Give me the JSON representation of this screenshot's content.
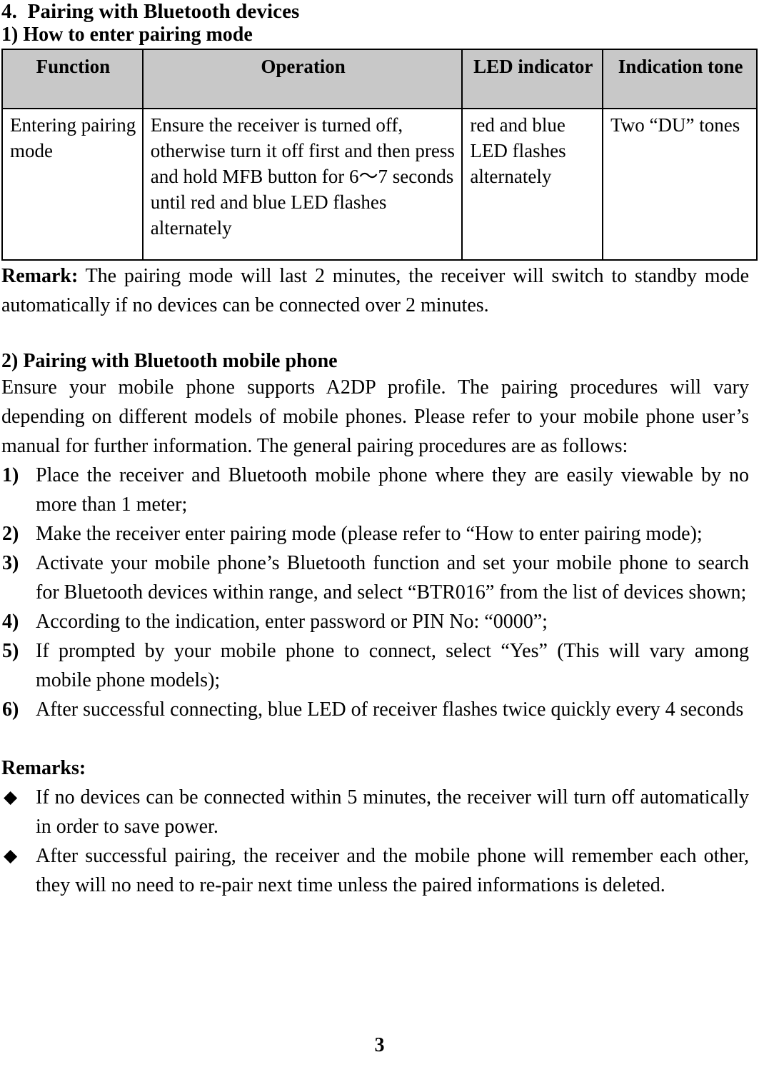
{
  "document": {
    "section_heading": "4.  Pairing with Bluetooth devices",
    "subsection_heading": "1) How to enter pairing mode",
    "page_number": "3"
  },
  "table": {
    "headers": {
      "function": "Function",
      "operation": "Operation",
      "led_indicator": "LED indicator",
      "indication_tone": "Indication tone"
    },
    "header_colors": {
      "background": "#c8c8c8",
      "border": "#000000"
    },
    "rows": [
      {
        "function": "Entering pairing mode",
        "operation": "Ensure the receiver is turned off, otherwise turn it off first and then press and hold MFB button for 6～7 seconds until red and blue LED flashes alternately",
        "led_indicator": "red and blue LED flashes alternately",
        "indication_tone": "Two  “DU” tones"
      }
    ]
  },
  "remark": {
    "label": "Remark:",
    "text": " The pairing mode will last 2 minutes, the receiver will switch to standby mode automatically if no devices can be connected over 2 minutes."
  },
  "pairing_phone": {
    "heading": "2) Pairing with Bluetooth mobile phone",
    "intro": "Ensure your mobile phone supports A2DP profile. The pairing procedures will vary depending on different models of mobile phones. Please refer to your mobile phone user’s manual for further information. The general pairing procedures are as follows:",
    "steps": [
      {
        "marker": "1)",
        "text": "Place the receiver and Bluetooth mobile phone where they are easily viewable by no more than 1 meter;"
      },
      {
        "marker": "2)",
        "text": "Make the receiver enter pairing mode (please refer to “How to enter pairing mode);"
      },
      {
        "marker": "3)",
        "text": "Activate your mobile phone’s Bluetooth function and set your mobile phone to search for Bluetooth devices within range, and select “BTR016” from the list of devices shown;"
      },
      {
        "marker": "4)",
        "text": "According to the indication, enter password or PIN No: “0000”;"
      },
      {
        "marker": "5)",
        "text": "If prompted by your mobile phone to connect, select “Yes” (This will vary among mobile phone models);"
      },
      {
        "marker": "6)",
        "text": "After  successful  connecting,  blue  LED  of  receiver  flashes   twice quickly every 4 seconds"
      }
    ]
  },
  "remarks": {
    "title": "Remarks:",
    "bullet_glyph": "◆",
    "items": [
      "If no devices can be connected within 5 minutes, the receiver will turn off automatically in order to save power.",
      "After successful pairing, the receiver and the mobile phone will remember each other, they will no need to re-pair next time unless the paired informations is deleted."
    ]
  }
}
